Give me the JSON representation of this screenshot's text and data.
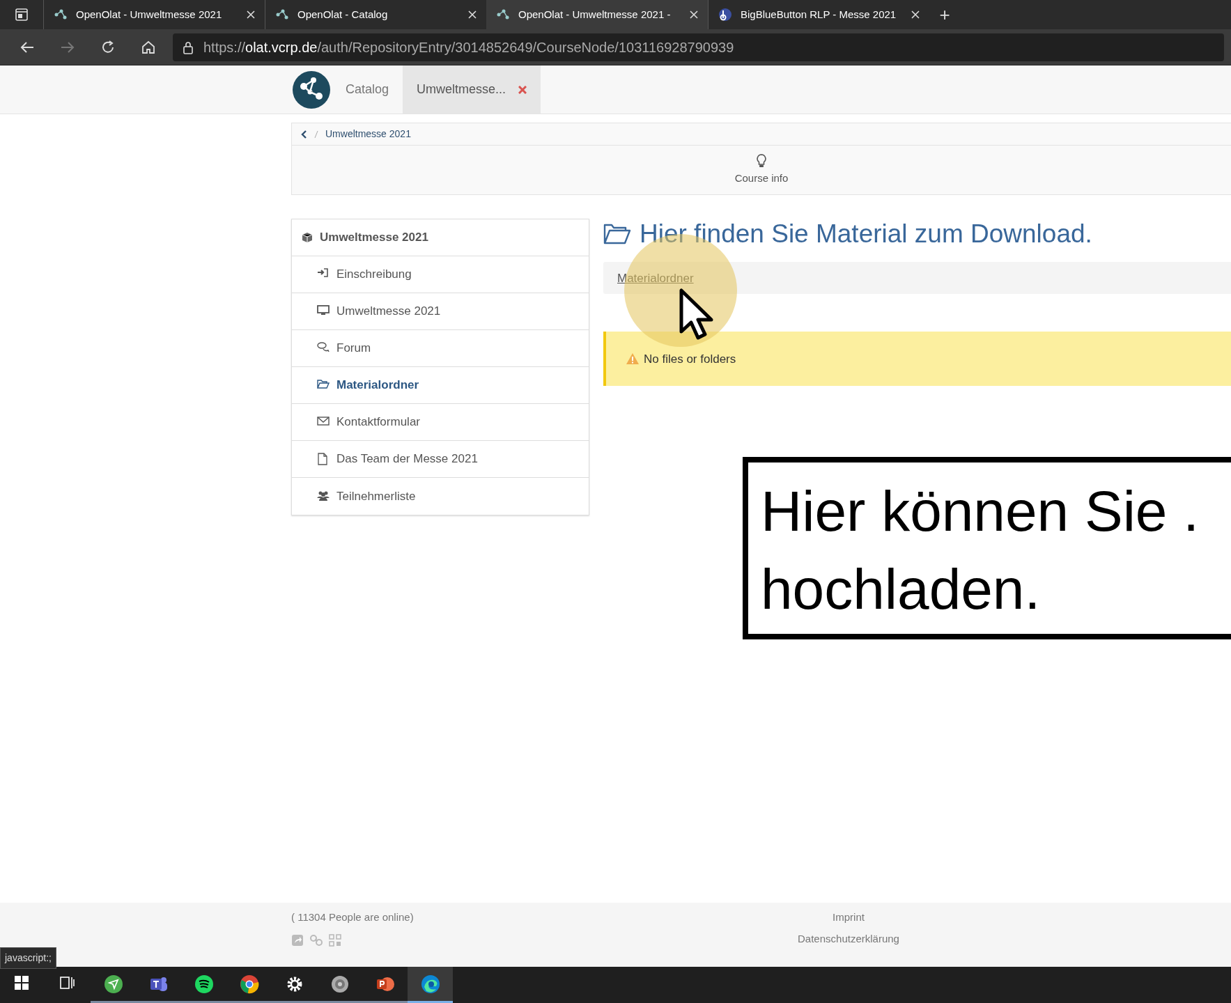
{
  "browser": {
    "tabs": [
      {
        "title": "OpenOlat - Umweltmesse 2021",
        "kind": "olat",
        "selected": false
      },
      {
        "title": "OpenOlat - Catalog",
        "kind": "olat",
        "selected": false
      },
      {
        "title": "OpenOlat - Umweltmesse 2021 -",
        "kind": "olat",
        "selected": true
      },
      {
        "title": "BigBlueButton RLP - Messe 2021",
        "kind": "bbb",
        "selected": false
      }
    ],
    "new_tab": "+",
    "url": {
      "scheme": "https://",
      "host": "olat.vcrp.de",
      "path": "/auth/RepositoryEntry/3014852649/CourseNode/103116928790939"
    }
  },
  "site_nav": [
    {
      "label": "Catalog",
      "closable": false,
      "selected": false
    },
    {
      "label": "Umweltmesse...",
      "closable": true,
      "selected": true
    }
  ],
  "breadcrumb": [
    "Umweltmesse 2021"
  ],
  "toolbar": [
    {
      "label": "Course info"
    }
  ],
  "course_menu": {
    "title": "Umweltmesse 2021",
    "children": [
      {
        "label": "Einschreibung",
        "kind": "enroll",
        "selected": false
      },
      {
        "label": "Umweltmesse 2021",
        "kind": "monitor",
        "selected": false
      },
      {
        "label": "Forum",
        "kind": "forum",
        "selected": false
      },
      {
        "label": "Materialordner",
        "kind": "folder",
        "selected": true
      },
      {
        "label": "Kontaktformular",
        "kind": "mail",
        "selected": false
      },
      {
        "label": "Das Team der Messe 2021",
        "kind": "page",
        "selected": false
      },
      {
        "label": "Teilnehmerliste",
        "kind": "people",
        "selected": false
      }
    ]
  },
  "content": {
    "heading": "Hier finden Sie Material zum Download.",
    "path": [
      "Materialordner"
    ],
    "warning": "No files or folders"
  },
  "callout": {
    "lines": [
      "Hier können Sie .",
      "hochladen."
    ]
  },
  "footer": {
    "online": "( 11304 People are online)",
    "links": [
      "Imprint",
      "Datenschutzerklärung"
    ]
  },
  "status_tooltip": "javascript:;",
  "taskbar": [
    {
      "kind": "start",
      "running": false,
      "selected": false
    },
    {
      "kind": "taskview",
      "running": false,
      "selected": false
    },
    {
      "kind": "green",
      "running": true,
      "selected": false
    },
    {
      "kind": "teams",
      "running": true,
      "selected": false
    },
    {
      "kind": "spotify",
      "running": true,
      "selected": false
    },
    {
      "kind": "chrome",
      "running": true,
      "selected": false
    },
    {
      "kind": "settings",
      "running": true,
      "selected": false
    },
    {
      "kind": "speaker",
      "running": true,
      "selected": false
    },
    {
      "kind": "powerpoint",
      "running": true,
      "selected": false
    },
    {
      "kind": "edge",
      "running": true,
      "selected": true
    }
  ]
}
